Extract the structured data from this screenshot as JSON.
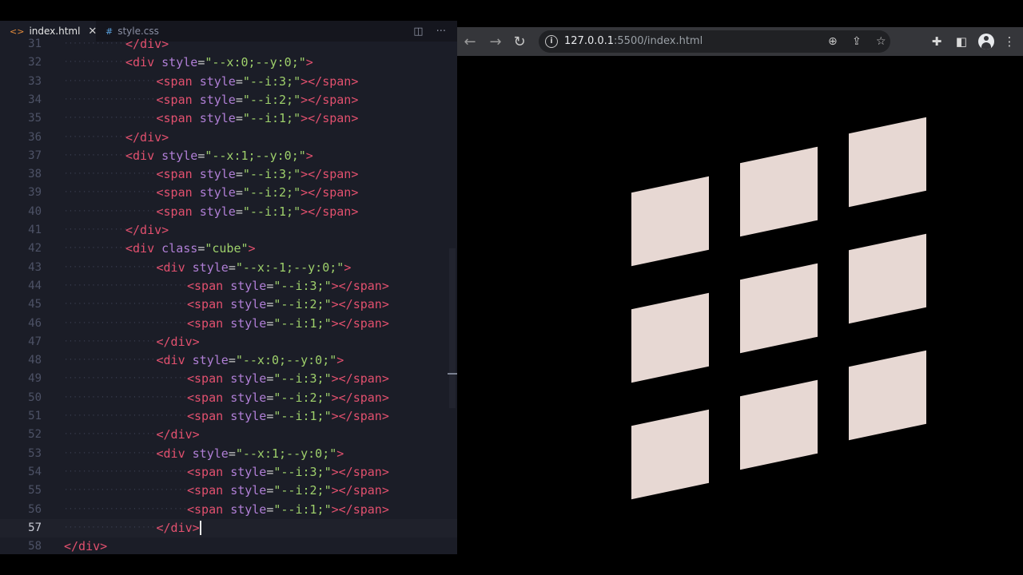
{
  "editor": {
    "tabs": [
      {
        "icon": "<>",
        "label": "index.html",
        "close": "✕"
      },
      {
        "icon": "#",
        "label": "style.css"
      }
    ],
    "actions": {
      "split": "◫",
      "more": "···"
    },
    "lines": [
      {
        "n": "31",
        "indent": 3,
        "parts": [
          [
            "tg",
            "</"
          ],
          [
            "tg",
            "div"
          ],
          [
            "tg",
            ">"
          ]
        ]
      },
      {
        "n": "32",
        "indent": 3,
        "parts": [
          [
            "tg",
            "<div"
          ],
          [
            "pu",
            " "
          ],
          [
            "at",
            "style"
          ],
          [
            "pu",
            "="
          ],
          [
            "st",
            "\"--x:0;--y:0;\""
          ],
          [
            "tg",
            ">"
          ]
        ]
      },
      {
        "n": "33",
        "indent": 4,
        "parts": [
          [
            "tg",
            "<span"
          ],
          [
            "pu",
            " "
          ],
          [
            "at",
            "style"
          ],
          [
            "pu",
            "="
          ],
          [
            "st",
            "\"--i:3;\""
          ],
          [
            "tg",
            "></span>"
          ]
        ]
      },
      {
        "n": "34",
        "indent": 4,
        "parts": [
          [
            "tg",
            "<span"
          ],
          [
            "pu",
            " "
          ],
          [
            "at",
            "style"
          ],
          [
            "pu",
            "="
          ],
          [
            "st",
            "\"--i:2;\""
          ],
          [
            "tg",
            "></span>"
          ]
        ]
      },
      {
        "n": "35",
        "indent": 4,
        "parts": [
          [
            "tg",
            "<span"
          ],
          [
            "pu",
            " "
          ],
          [
            "at",
            "style"
          ],
          [
            "pu",
            "="
          ],
          [
            "st",
            "\"--i:1;\""
          ],
          [
            "tg",
            "></span>"
          ]
        ]
      },
      {
        "n": "36",
        "indent": 3,
        "parts": [
          [
            "tg",
            "</div>"
          ]
        ]
      },
      {
        "n": "37",
        "indent": 3,
        "parts": [
          [
            "tg",
            "<div"
          ],
          [
            "pu",
            " "
          ],
          [
            "at",
            "style"
          ],
          [
            "pu",
            "="
          ],
          [
            "st",
            "\"--x:1;--y:0;\""
          ],
          [
            "tg",
            ">"
          ]
        ]
      },
      {
        "n": "38",
        "indent": 4,
        "parts": [
          [
            "tg",
            "<span"
          ],
          [
            "pu",
            " "
          ],
          [
            "at",
            "style"
          ],
          [
            "pu",
            "="
          ],
          [
            "st",
            "\"--i:3;\""
          ],
          [
            "tg",
            "></span>"
          ]
        ]
      },
      {
        "n": "39",
        "indent": 4,
        "parts": [
          [
            "tg",
            "<span"
          ],
          [
            "pu",
            " "
          ],
          [
            "at",
            "style"
          ],
          [
            "pu",
            "="
          ],
          [
            "st",
            "\"--i:2;\""
          ],
          [
            "tg",
            "></span>"
          ]
        ]
      },
      {
        "n": "40",
        "indent": 4,
        "parts": [
          [
            "tg",
            "<span"
          ],
          [
            "pu",
            " "
          ],
          [
            "at",
            "style"
          ],
          [
            "pu",
            "="
          ],
          [
            "st",
            "\"--i:1;\""
          ],
          [
            "tg",
            "></span>"
          ]
        ]
      },
      {
        "n": "41",
        "indent": 3,
        "parts": [
          [
            "tg",
            "</div>"
          ]
        ]
      },
      {
        "n": "42",
        "indent": 3,
        "parts": [
          [
            "tg",
            "<div"
          ],
          [
            "pu",
            " "
          ],
          [
            "at",
            "class"
          ],
          [
            "pu",
            "="
          ],
          [
            "st",
            "\"cube\""
          ],
          [
            "tg",
            ">"
          ]
        ]
      },
      {
        "n": "43",
        "indent": 4,
        "parts": [
          [
            "tg",
            "<div"
          ],
          [
            "pu",
            " "
          ],
          [
            "at",
            "style"
          ],
          [
            "pu",
            "="
          ],
          [
            "st",
            "\"--x:-1;--y:0;\""
          ],
          [
            "tg",
            ">"
          ]
        ]
      },
      {
        "n": "44",
        "indent": 5,
        "parts": [
          [
            "tg",
            "<span"
          ],
          [
            "pu",
            " "
          ],
          [
            "at",
            "style"
          ],
          [
            "pu",
            "="
          ],
          [
            "st",
            "\"--i:3;\""
          ],
          [
            "tg",
            "></span>"
          ]
        ]
      },
      {
        "n": "45",
        "indent": 5,
        "parts": [
          [
            "tg",
            "<span"
          ],
          [
            "pu",
            " "
          ],
          [
            "at",
            "style"
          ],
          [
            "pu",
            "="
          ],
          [
            "st",
            "\"--i:2;\""
          ],
          [
            "tg",
            "></span>"
          ]
        ]
      },
      {
        "n": "46",
        "indent": 5,
        "parts": [
          [
            "tg",
            "<span"
          ],
          [
            "pu",
            " "
          ],
          [
            "at",
            "style"
          ],
          [
            "pu",
            "="
          ],
          [
            "st",
            "\"--i:1;\""
          ],
          [
            "tg",
            "></span>"
          ]
        ]
      },
      {
        "n": "47",
        "indent": 4,
        "parts": [
          [
            "tg",
            "</div>"
          ]
        ]
      },
      {
        "n": "48",
        "indent": 4,
        "parts": [
          [
            "tg",
            "<div"
          ],
          [
            "pu",
            " "
          ],
          [
            "at",
            "style"
          ],
          [
            "pu",
            "="
          ],
          [
            "st",
            "\"--x:0;--y:0;\""
          ],
          [
            "tg",
            ">"
          ]
        ]
      },
      {
        "n": "49",
        "indent": 5,
        "parts": [
          [
            "tg",
            "<span"
          ],
          [
            "pu",
            " "
          ],
          [
            "at",
            "style"
          ],
          [
            "pu",
            "="
          ],
          [
            "st",
            "\"--i:3;\""
          ],
          [
            "tg",
            "></span>"
          ]
        ]
      },
      {
        "n": "50",
        "indent": 5,
        "parts": [
          [
            "tg",
            "<span"
          ],
          [
            "pu",
            " "
          ],
          [
            "at",
            "style"
          ],
          [
            "pu",
            "="
          ],
          [
            "st",
            "\"--i:2;\""
          ],
          [
            "tg",
            "></span>"
          ]
        ]
      },
      {
        "n": "51",
        "indent": 5,
        "parts": [
          [
            "tg",
            "<span"
          ],
          [
            "pu",
            " "
          ],
          [
            "at",
            "style"
          ],
          [
            "pu",
            "="
          ],
          [
            "st",
            "\"--i:1;\""
          ],
          [
            "tg",
            "></span>"
          ]
        ]
      },
      {
        "n": "52",
        "indent": 4,
        "parts": [
          [
            "tg",
            "</div>"
          ]
        ]
      },
      {
        "n": "53",
        "indent": 4,
        "parts": [
          [
            "tg",
            "<div"
          ],
          [
            "pu",
            " "
          ],
          [
            "at",
            "style"
          ],
          [
            "pu",
            "="
          ],
          [
            "st",
            "\"--x:1;--y:0;\""
          ],
          [
            "tg",
            ">"
          ]
        ]
      },
      {
        "n": "54",
        "indent": 5,
        "parts": [
          [
            "tg",
            "<span"
          ],
          [
            "pu",
            " "
          ],
          [
            "at",
            "style"
          ],
          [
            "pu",
            "="
          ],
          [
            "st",
            "\"--i:3;\""
          ],
          [
            "tg",
            "></span>"
          ]
        ]
      },
      {
        "n": "55",
        "indent": 5,
        "parts": [
          [
            "tg",
            "<span"
          ],
          [
            "pu",
            " "
          ],
          [
            "at",
            "style"
          ],
          [
            "pu",
            "="
          ],
          [
            "st",
            "\"--i:2;\""
          ],
          [
            "tg",
            "></span>"
          ]
        ]
      },
      {
        "n": "56",
        "indent": 5,
        "parts": [
          [
            "tg",
            "<span"
          ],
          [
            "pu",
            " "
          ],
          [
            "at",
            "style"
          ],
          [
            "pu",
            "="
          ],
          [
            "st",
            "\"--i:1;\""
          ],
          [
            "tg",
            "></span>"
          ]
        ]
      },
      {
        "n": "57",
        "indent": 4,
        "current": true,
        "parts": [
          [
            "tg",
            "</div>"
          ]
        ]
      },
      {
        "n": "58",
        "indent": 1,
        "parts": [
          [
            "tg",
            "</div>"
          ]
        ]
      }
    ]
  },
  "browser": {
    "nav": {
      "back": "←",
      "forward": "→",
      "reload": "↻"
    },
    "url": {
      "info_icon": "i",
      "host": "127.0.0.1",
      "rest": ":5500/index.html"
    },
    "omni_icons": {
      "zoom": "⊕",
      "share": "⇪",
      "bookmark": "☆"
    },
    "toolbar_icons": {
      "extensions": "✚",
      "sidepanel": "◧",
      "menu": "⋮"
    },
    "tile_color": "#e7d8d3",
    "tiles": 9
  }
}
